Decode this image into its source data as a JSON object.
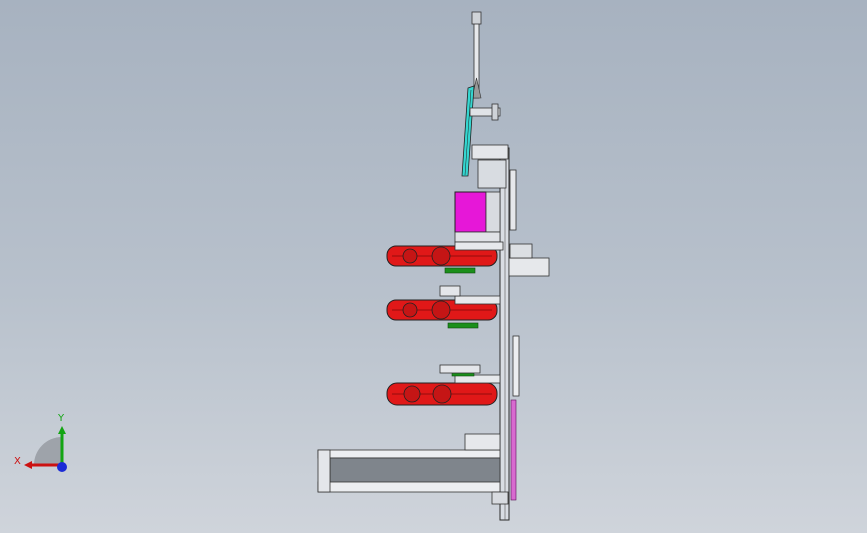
{
  "viewport": {
    "background_top": "#a7b2c0",
    "background_bottom": "#cfd4db"
  },
  "triad": {
    "x_label": "X",
    "y_label": "Y",
    "x_color": "#cc1111",
    "y_color": "#13a513",
    "z_color": "#1b2bd6"
  },
  "model": {
    "highlight_colors": {
      "wheel": "#e01818",
      "motor": "#e617d8",
      "cylinder": "#35d6d0",
      "gear": "#1a8f1a",
      "frame": "#2b2b2b"
    }
  }
}
